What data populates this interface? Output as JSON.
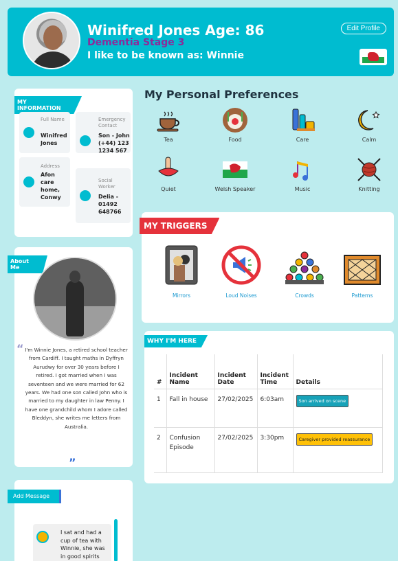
{
  "header": {
    "name_age": "Winifred Jones Age: 86",
    "stage": "Dementia Stage 3",
    "known_as": "I like to be known as: Winnie",
    "edit_button": "Edit Profile",
    "flag_icon": "welsh-flag-icon"
  },
  "my_information": {
    "tag": "MY INFORMATION",
    "items": [
      {
        "label": "Full Name",
        "value": "Winifred Jones"
      },
      {
        "label": "Emergency Contact",
        "value": "Son - John (+44) 123 1234 567"
      },
      {
        "label": "Address",
        "value": "Afon care home, Conwy"
      },
      {
        "label": "Social Worker",
        "value": "Delia - 01492 648766"
      }
    ]
  },
  "about_me": {
    "tag": "About Me",
    "text": "I'm Winnie Jones, a retired school teacher from Cardiff. I taught maths in Dyffryn Aurudwy for over 30 years before I retired. I got married when I was seventeen and we were married for 62 years. We had one son called John who is married to my daughter in law Penny. I have one grandchild whom I adore called Bleddyn, she writes me letters from Australia."
  },
  "messages": {
    "add_button": "Add Message",
    "items": [
      {
        "text": "I sat and had a cup of tea with Winnie, she was in good spirits"
      }
    ]
  },
  "preferences": {
    "title": "My Personal Preferences",
    "items": [
      {
        "label": "Tea",
        "icon": "tea-cup-icon"
      },
      {
        "label": "Food",
        "icon": "food-plate-icon"
      },
      {
        "label": "Care",
        "icon": "care-toiletries-icon"
      },
      {
        "label": "Calm",
        "icon": "moon-stars-icon"
      },
      {
        "label": "Quiet",
        "icon": "quiet-finger-lips-icon"
      },
      {
        "label": "Welsh Speaker",
        "icon": "welsh-flag-icon"
      },
      {
        "label": "Music",
        "icon": "music-notes-icon"
      },
      {
        "label": "Knitting",
        "icon": "knitting-yarn-icon"
      }
    ]
  },
  "triggers": {
    "tag": "MY TRIGGERS",
    "items": [
      {
        "label": "Mirrors",
        "icon": "mirror-icon"
      },
      {
        "label": "Loud Noises",
        "icon": "no-megaphone-icon"
      },
      {
        "label": "Crowds",
        "icon": "crowd-icon"
      },
      {
        "label": "Patterns",
        "icon": "pattern-icon"
      }
    ]
  },
  "why_here": {
    "tag": "WHY I'M HERE",
    "columns": [
      "#",
      "Incident Name",
      "Incident Date",
      "Incident Time",
      "Details"
    ],
    "rows": [
      {
        "num": "1",
        "name": "Fall in house",
        "date": "27/02/2025",
        "time": "6:03am",
        "detail": "Son arrived on scene",
        "badge": "teal"
      },
      {
        "num": "2",
        "name": "Confusion Episode",
        "date": "27/02/2025",
        "time": "3:30pm",
        "detail": "Caregiver provided reassurance",
        "badge": "yellow"
      }
    ]
  },
  "colors": {
    "accent": "#00bcd0",
    "stage": "#8b2c9a",
    "trigger": "#e5323b",
    "background": "#bdecee"
  }
}
